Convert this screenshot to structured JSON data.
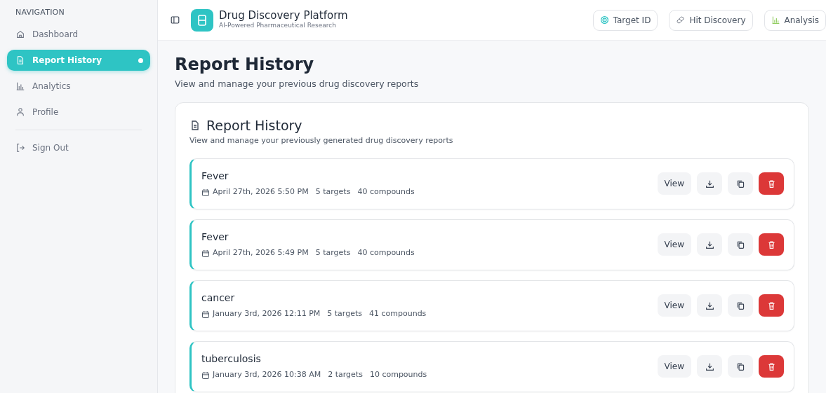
{
  "sidebar": {
    "heading": "NAVIGATION",
    "items": [
      {
        "label": "Dashboard",
        "selected": false
      },
      {
        "label": "Report History",
        "selected": true
      },
      {
        "label": "Analytics",
        "selected": false
      },
      {
        "label": "Profile",
        "selected": false
      }
    ],
    "footer_items": [
      {
        "label": "Sign Out"
      }
    ]
  },
  "header": {
    "title": "Drug Discovery Platform",
    "subtitle": "AI-Powered Pharmaceutical Research",
    "buttons": [
      {
        "label": "Target ID"
      },
      {
        "label": "Hit Discovery"
      },
      {
        "label": "Analysis"
      }
    ]
  },
  "page": {
    "title": "Report History",
    "subtitle": "View and manage your previous drug discovery reports"
  },
  "card": {
    "title": "Report History",
    "subtitle": "View and manage your previously generated drug discovery reports",
    "reports": [
      {
        "name": "Fever",
        "date": "April 27th, 2026 5:50 PM",
        "targets": "5 targets",
        "compounds": "40 compounds",
        "view_label": "View"
      },
      {
        "name": "Fever",
        "date": "April 27th, 2026 5:49 PM",
        "targets": "5 targets",
        "compounds": "40 compounds",
        "view_label": "View"
      },
      {
        "name": "cancer",
        "date": "January 3rd, 2026 12:11 PM",
        "targets": "5 targets",
        "compounds": "41 compounds",
        "view_label": "View"
      },
      {
        "name": "tuberculosis",
        "date": "January 3rd, 2026 10:38 AM",
        "targets": "2 targets",
        "compounds": "10 compounds",
        "view_label": "View"
      }
    ]
  }
}
